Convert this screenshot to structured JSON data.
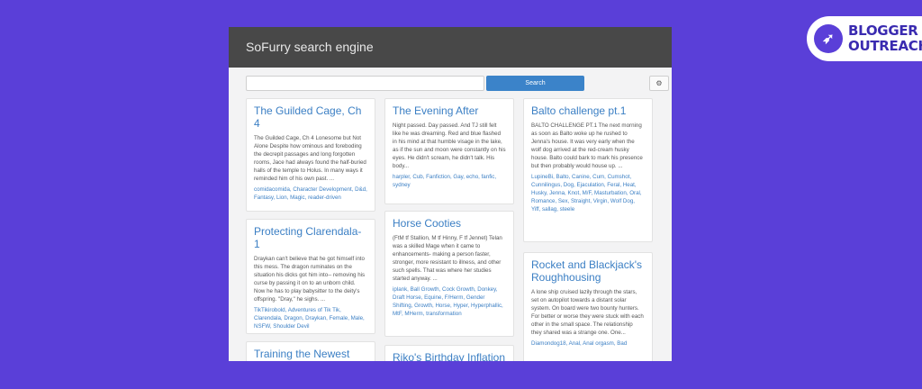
{
  "badge": {
    "line1": "BLOGGER",
    "line2": "OUTREACH"
  },
  "app": {
    "title": "SoFurry search engine"
  },
  "search": {
    "placeholder": "",
    "button_label": "Search",
    "settings_icon": "⚙"
  },
  "columns": [
    [
      {
        "title": "The Guilded Cage, Ch 4",
        "desc": "The Guilded Cage, Ch 4 Lonesome but Not Alone Despite how ominous and foreboding the decrepit passages and long forgotten rooms, Jace had always found the half-buried halls of the temple to Holus. In many ways it reminded him of his own past. ...",
        "tags": "comidacomida, Character Development, D&d, Fantasy, Lion, Magic, reader-driven"
      },
      {
        "title": "Protecting Clarendala-1",
        "desc": "Draykan can't believe that he got himself into this mess. The dragon ruminates on the situation his dicks got him into-- removing his curse by passing it on to an unborn child. Now he has to play babysitter to the deity's offspring. \"Dray,\" he sighs. ...",
        "tags": "TikTikirobold, Adventures of Tik Tik, Clarendala, Dragon, Draykan, Female, Male, NSFW, Shoulder Devil"
      },
      {
        "title": "Training the Newest",
        "desc": "",
        "tags": ""
      }
    ],
    [
      {
        "title": "The Evening After",
        "desc": "Night passed. Day passed. And TJ still felt like he was dreaming. Red and blue flashed in his mind at that humble visage in the lake, as if the sun and moon were constantly on his eyes. He didn't scream, he didn't talk. His body...",
        "tags": "harpler, Cub, Fanfiction, Gay, echo, fanfic, sydney"
      },
      {
        "title": "Horse Cooties",
        "desc": "(FtM tf Stallion, M tf Hinny, F tf Jennet) Telan was a skilled Mage when it came to enhancements- making a person faster, stronger, more resistant to illness, and other such spells. That was where her studies started anyway. ...",
        "tags": "iplank, Ball Growth, Cock Growth, Donkey, Draft Horse, Equine, F/Herm, Gender Shifting, Growth, Horse, Hyper, Hyperphallic, MtF, MHerm, transformation"
      },
      {
        "title": "Riko's Birthday Inflation",
        "desc": "",
        "tags": ""
      }
    ],
    [
      {
        "title": "Balto challenge pt.1",
        "desc": "BALTO CHALLENGE PT.1 The next morning as soon as Balto woke up he rushed to Jenna's house. It was very early when the wolf dog arrived at the red-cream husky house. Balto could bark to mark his presence but then probably would house up. ...",
        "tags": "LupineBi, Balto, Canine, Cum, Cumshot, Cunnilingus, Dog, Ejaculation, Feral, Heat, Husky, Jenna, Knot, M/F, Masturbation, Oral, Romance, Sex, Straight, Virgin, Wolf Dog, Yiff, sallag, steele"
      },
      {
        "title": "Rocket and Blackjack's Roughhousing",
        "desc": "A lone ship cruised lazily through the stars, set on autopilot towards a distant solar system. On board were two bounty hunters. For better or worse they were stuck with each other in the small space. The relationship they shared was a strange one. One...",
        "tags": "Diamondog18, Anal, Anal orgasm, Bad"
      }
    ]
  ]
}
